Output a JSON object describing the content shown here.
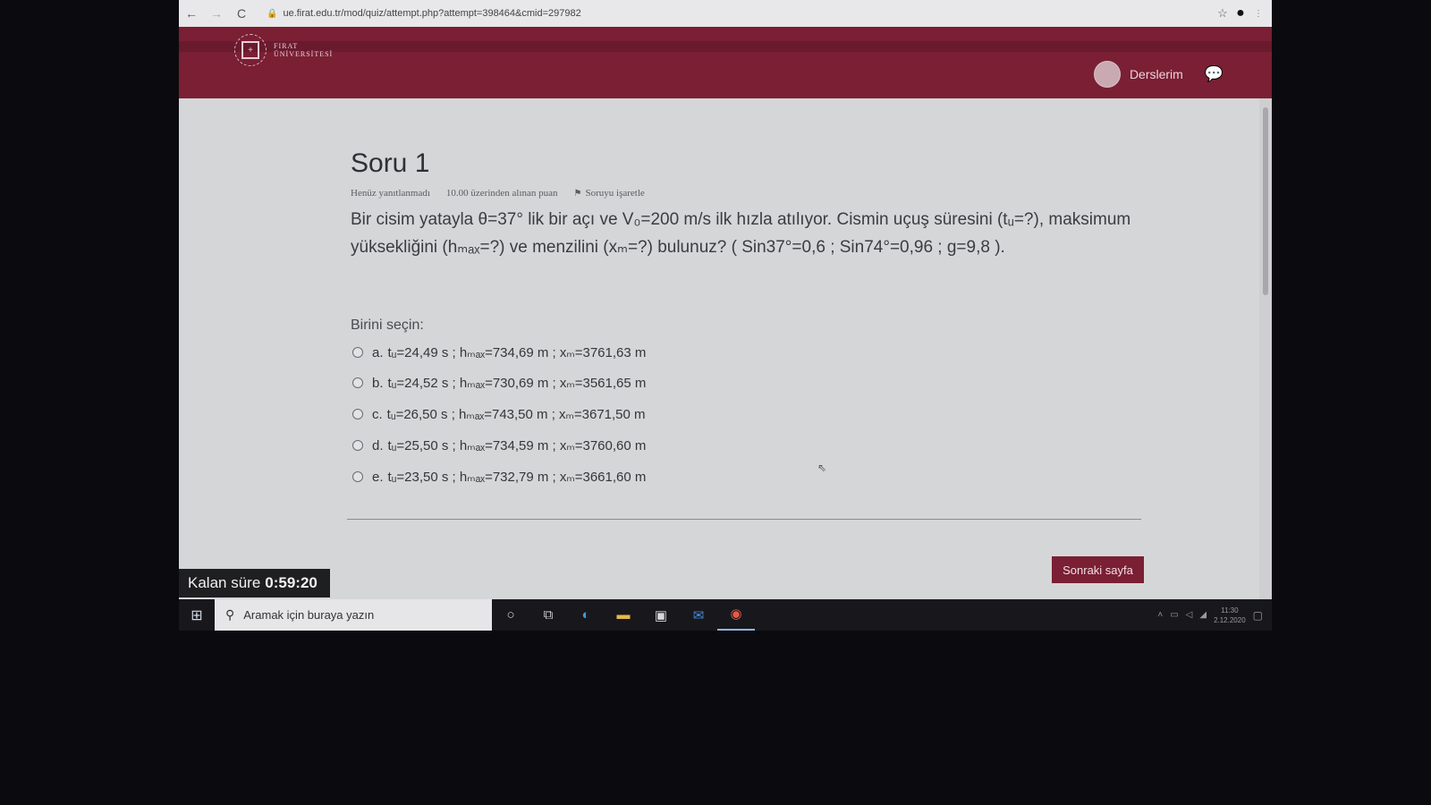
{
  "browser": {
    "back": "←",
    "forward": "→",
    "reload": "C",
    "url": "ue.firat.edu.tr/mod/quiz/attempt.php?attempt=398464&cmid=297982"
  },
  "header": {
    "logo_line1": "FIRAT",
    "logo_line2": "ÜNİVERSİTESİ",
    "link": "Derslerim"
  },
  "question": {
    "title": "Soru 1",
    "status": "Henüz yanıtlanmadı",
    "points": "10.00 üzerinden alınan puan",
    "flag_label": "Soruyu işaretle",
    "text": "Bir cisim yatayla θ=37° lik bir açı ve V₀=200 m/s ilk hızla atılıyor. Cismin uçuş süresini (tᵤ=?), maksimum yüksekliğini (hₘₐₓ=?) ve menzilini (xₘ=?) bulunuz? ( Sin37°=0,6 ; Sin74°=0,96 ; g=9,8 ).",
    "choose_label": "Birini seçin:",
    "options": [
      {
        "letter": "a.",
        "text": "tᵤ=24,49 s ; hₘₐₓ=734,69 m ; xₘ=3761,63 m"
      },
      {
        "letter": "b.",
        "text": "tᵤ=24,52 s ; hₘₐₓ=730,69 m ; xₘ=3561,65 m"
      },
      {
        "letter": "c.",
        "text": "tᵤ=26,50 s ; hₘₐₓ=743,50 m ; xₘ=3671,50 m"
      },
      {
        "letter": "d.",
        "text": "tᵤ=25,50 s ; hₘₐₓ=734,59 m ; xₘ=3760,60 m"
      },
      {
        "letter": "e.",
        "text": "tᵤ=23,50 s ; hₘₐₓ=732,79 m ; xₘ=3661,60 m"
      }
    ],
    "next_label": "Sonraki sayfa"
  },
  "timer": {
    "label": "Kalan süre",
    "value": "0:59:20"
  },
  "taskbar": {
    "search_placeholder": "Aramak için buraya yazın",
    "time": "11:30",
    "date": "2.12.2020"
  }
}
